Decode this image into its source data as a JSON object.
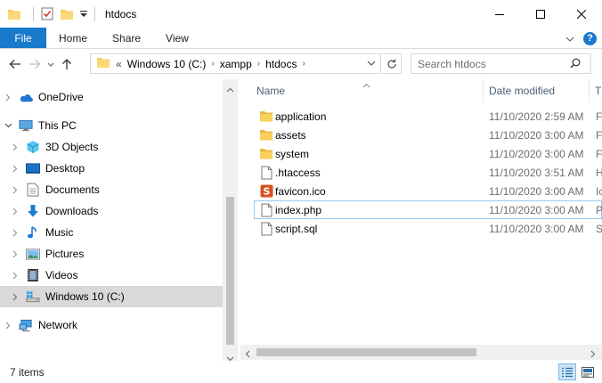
{
  "window": {
    "title": "htdocs",
    "controls": {
      "minimize": "minimize-icon",
      "maximize": "maximize-icon",
      "close": "close-icon"
    }
  },
  "ribbon": {
    "tabs": [
      "File",
      "Home",
      "Share",
      "View"
    ],
    "accent": "#1979ca"
  },
  "address": {
    "overflow": "«",
    "crumbs": [
      "Windows 10 (C:)",
      "xampp",
      "htdocs"
    ],
    "search_placeholder": "Search htdocs"
  },
  "nav": {
    "items": [
      {
        "label": "OneDrive",
        "icon": "cloud-icon"
      },
      {
        "label": "This PC",
        "icon": "computer-icon"
      },
      {
        "label": "3D Objects",
        "icon": "cube-icon"
      },
      {
        "label": "Desktop",
        "icon": "desktop-icon"
      },
      {
        "label": "Documents",
        "icon": "document-icon"
      },
      {
        "label": "Downloads",
        "icon": "download-arrow-icon"
      },
      {
        "label": "Music",
        "icon": "music-note-icon"
      },
      {
        "label": "Pictures",
        "icon": "picture-icon"
      },
      {
        "label": "Videos",
        "icon": "film-icon"
      },
      {
        "label": "Windows 10 (C:)",
        "icon": "drive-icon",
        "selected": true
      },
      {
        "label": "Network",
        "icon": "network-icon"
      }
    ]
  },
  "columns": {
    "name": "Name",
    "date": "Date modified",
    "type_partial": "T"
  },
  "files": [
    {
      "name": "application",
      "date": "11/10/2020 2:59 AM",
      "type": "F",
      "icon": "folder-icon"
    },
    {
      "name": "assets",
      "date": "11/10/2020 3:00 AM",
      "type": "F",
      "icon": "folder-icon"
    },
    {
      "name": "system",
      "date": "11/10/2020 3:00 AM",
      "type": "F",
      "icon": "folder-icon"
    },
    {
      "name": ".htaccess",
      "date": "11/10/2020 3:51 AM",
      "type": "H",
      "icon": "file-icon"
    },
    {
      "name": "favicon.ico",
      "date": "11/10/2020 3:00 AM",
      "type": "Ic",
      "icon": "favicon-icon"
    },
    {
      "name": "index.php",
      "date": "11/10/2020 3:00 AM",
      "type": "P",
      "icon": "file-icon",
      "focused": true
    },
    {
      "name": "script.sql",
      "date": "11/10/2020 3:00 AM",
      "type": "S",
      "icon": "file-icon"
    }
  ],
  "status": {
    "count": "7 items"
  }
}
